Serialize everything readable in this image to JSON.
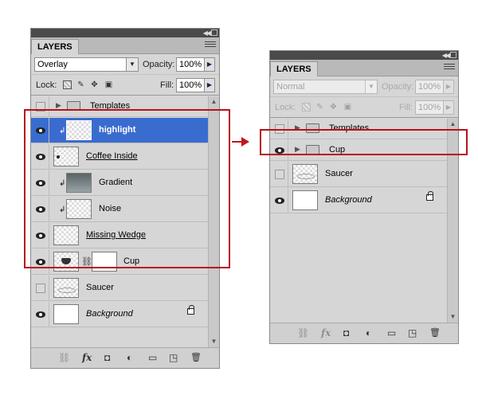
{
  "left_panel": {
    "tab_label": "LAYERS",
    "blend_mode": "Overlay",
    "opacity_label": "Opacity:",
    "opacity_value": "100%",
    "lock_label": "Lock:",
    "fill_label": "Fill:",
    "fill_value": "100%",
    "layers": [
      {
        "name": "Templates",
        "type": "group",
        "visible": false
      },
      {
        "name": "highlight",
        "type": "layer",
        "visible": true,
        "clipped": true,
        "selected": true
      },
      {
        "name": "Coffee Inside",
        "type": "layer",
        "visible": true,
        "clipped": false
      },
      {
        "name": "Gradient",
        "type": "layer",
        "visible": true,
        "clipped": true
      },
      {
        "name": "Noise",
        "type": "layer",
        "visible": true,
        "clipped": true
      },
      {
        "name": "Missing Wedge",
        "type": "layer",
        "visible": true
      },
      {
        "name": "Cup",
        "type": "layer",
        "visible": true,
        "mask": true
      },
      {
        "name": "Saucer",
        "type": "layer",
        "visible": false
      },
      {
        "name": "Background",
        "type": "background",
        "visible": true,
        "locked": true
      }
    ]
  },
  "right_panel": {
    "tab_label": "LAYERS",
    "blend_mode": "Normal",
    "opacity_label": "Opacity:",
    "opacity_value": "100%",
    "lock_label": "Lock:",
    "fill_label": "Fill:",
    "fill_value": "100%",
    "layers": [
      {
        "name": "Templates",
        "type": "group",
        "visible": false
      },
      {
        "name": "Cup",
        "type": "group",
        "visible": true
      },
      {
        "name": "Saucer",
        "type": "layer",
        "visible": false
      },
      {
        "name": "Background",
        "type": "background",
        "visible": true,
        "locked": true
      }
    ]
  },
  "bottom_icons": [
    "link-icon",
    "fx-icon",
    "add-mask-icon",
    "adjustment-layer-icon",
    "new-group-icon",
    "new-layer-icon",
    "trash-icon"
  ],
  "bottom_glyphs": {
    "link": "⛓",
    "fx": "fx",
    "mask": "◘",
    "adjust": "◐",
    "group": "▭",
    "newlayer": "◳",
    "trash": "🗑"
  },
  "colors": {
    "selected_row": "#3a6ccf",
    "annotation_red": "#b8111b",
    "panel_bg": "#d6d6d6"
  }
}
